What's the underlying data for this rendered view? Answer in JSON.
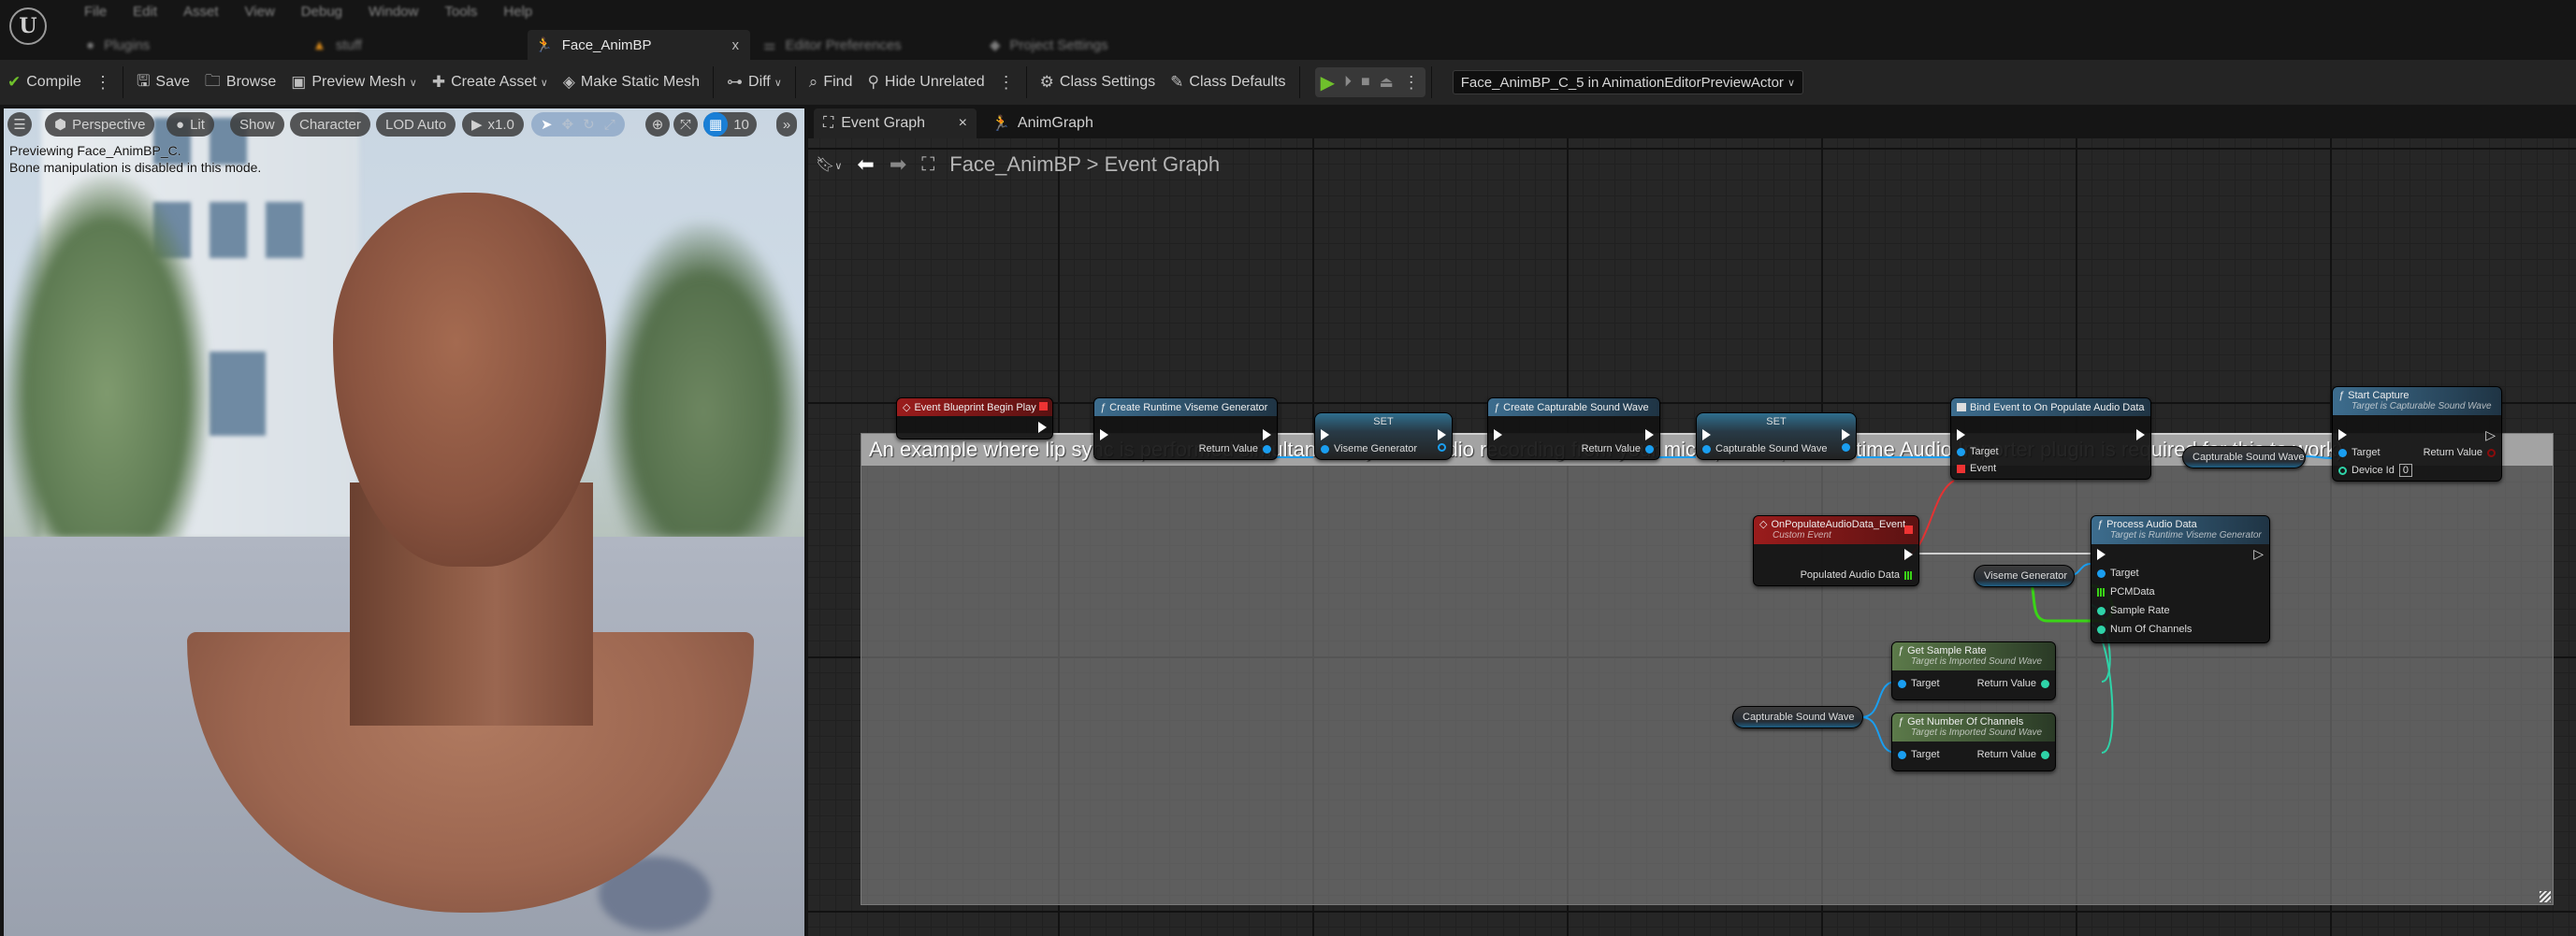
{
  "app": {
    "logo": "U",
    "menu": [
      "File",
      "Edit",
      "Asset",
      "View",
      "Debug",
      "Window",
      "Tools",
      "Help"
    ],
    "doc_tabs": [
      {
        "label": "Plugins",
        "icon": "plugin-icon",
        "active": false
      },
      {
        "label": "stuff",
        "icon": "level-icon",
        "active": false
      },
      {
        "label": "Face_AnimBP",
        "icon": "anim-blueprint-icon",
        "active": true,
        "close": "x"
      },
      {
        "label": "Editor Preferences",
        "icon": "preferences-icon",
        "active": false
      },
      {
        "label": "Project Settings",
        "icon": "settings-icon",
        "active": false
      }
    ]
  },
  "toolbar": {
    "compile": "Compile",
    "save": "Save",
    "browse": "Browse",
    "preview_mesh": "Preview Mesh",
    "create_asset": "Create Asset",
    "make_static_mesh": "Make Static Mesh",
    "diff": "Diff",
    "find": "Find",
    "hide_unrelated": "Hide Unrelated",
    "class_settings": "Class Settings",
    "class_defaults": "Class Defaults",
    "debug_object": "Face_AnimBP_C_5 in AnimationEditorPreviewActor",
    "accent_play": "#6fc02c"
  },
  "viewport": {
    "perspective": "Perspective",
    "lit": "Lit",
    "show": "Show",
    "character": "Character",
    "lod": "LOD Auto",
    "speed": "x1.0",
    "grid_size": "10",
    "message_line1": "Previewing Face_AnimBP_C.",
    "message_line2": "Bone manipulation is disabled in this mode."
  },
  "graph": {
    "tabs": [
      {
        "label": "Event Graph",
        "close": "×",
        "active": true
      },
      {
        "label": "AnimGraph",
        "active": false
      }
    ],
    "breadcrumb": {
      "root": "Face_AnimBP",
      "separator": ">",
      "current": "Event Graph"
    },
    "comment": "An example where lip sync is performed simultaneously with audio recording from your microphone (the Runtime Audio Importer plugin is required for this to work)",
    "nodes": {
      "begin_play": {
        "title": "Event Blueprint Begin Play"
      },
      "create_viseme": {
        "title": "Create Runtime Viseme Generator",
        "return": "Return Value"
      },
      "set_viseme": {
        "title": "SET",
        "pin": "Viseme Generator"
      },
      "create_wave": {
        "title": "Create Capturable Sound Wave",
        "return": "Return Value"
      },
      "set_wave": {
        "title": "SET",
        "pin": "Capturable Sound Wave"
      },
      "bind_event": {
        "title": "Bind Event to On Populate Audio Data",
        "target": "Target",
        "event": "Event"
      },
      "wave_var_top": {
        "label": "Capturable Sound Wave"
      },
      "start_capture": {
        "title": "Start Capture",
        "subtitle": "Target is Capturable Sound Wave",
        "target": "Target",
        "return": "Return Value",
        "device_id": "Device Id",
        "device_id_value": "0"
      },
      "on_populate": {
        "title": "OnPopulateAudioData_Event",
        "subtitle": "Custom Event",
        "out": "Populated Audio Data"
      },
      "viseme_var": {
        "label": "Viseme Generator"
      },
      "process_audio": {
        "title": "Process Audio Data",
        "subtitle": "Target is Runtime Viseme Generator",
        "target": "Target",
        "pcm": "PCMData",
        "sample_rate": "Sample Rate",
        "channels": "Num Of Channels"
      },
      "get_sample_rate": {
        "title": "Get Sample Rate",
        "subtitle": "Target is Imported Sound Wave",
        "target": "Target",
        "return": "Return Value"
      },
      "get_channels": {
        "title": "Get Number Of Channels",
        "subtitle": "Target is Imported Sound Wave",
        "target": "Target",
        "return": "Return Value"
      },
      "wave_var_bottom": {
        "label": "Capturable Sound Wave"
      }
    },
    "colors": {
      "object_pin": "#1a9ef0",
      "int_pin": "#2ed3a8",
      "array_pin": "#3ad417",
      "delegate_pin": "#e33333",
      "exec_wire": "#cfcfcf"
    }
  }
}
